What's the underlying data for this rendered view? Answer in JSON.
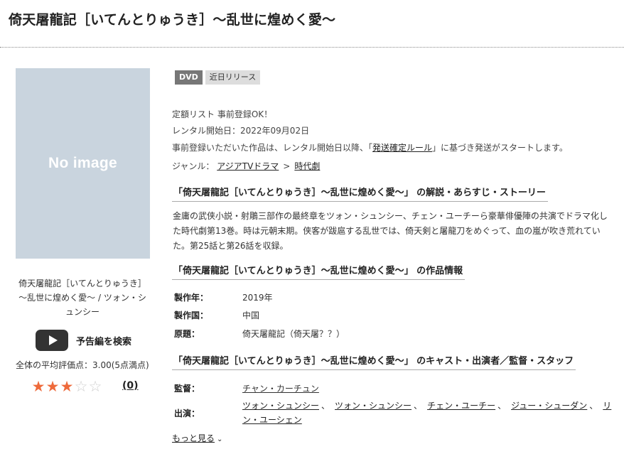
{
  "page_title": "倚天屠龍記［いてんとりゅうき］～乱世に煌めく愛～",
  "cover": {
    "placeholder_text": "No image"
  },
  "left": {
    "title_line1": "倚天屠龍記［いてんとりゅうき］",
    "title_line2": "～乱世に煌めく愛～ / ツォン・シ",
    "title_line3": "ュンシー",
    "trailer_label": "予告編を検索",
    "trailer_icon": "play-icon",
    "avg_rating_text": "全体の平均評価点：3.00(5点満点)",
    "rating": 3,
    "rating_max": 5,
    "star_color": "#ee6a3b",
    "review_count_open": "(",
    "review_count": "0",
    "review_count_close": ")"
  },
  "badges": {
    "format": "DVD",
    "status": "近日リリース"
  },
  "info": {
    "line1": "定額リスト 事前登録OK！",
    "line2": "レンタル開始日：2022年09月02日",
    "line3_pre": "事前登録いただいた作品は、レンタル開始日以降、「",
    "line3_link": "発送確定ルール",
    "line3_post": "」に基づき発送がスタートします。",
    "genre_label": "ジャンル：",
    "genre_1": "アジアTVドラマ",
    "genre_sep": ">",
    "genre_2": "時代劇"
  },
  "synopsis": {
    "heading": "「倚天屠龍記［いてんとりゅうき］～乱世に煌めく愛～」 の解説・あらすじ・ストーリー",
    "text": "金庸の武侠小説・射鵰三部作の最終章をツォン・シュンシー、チェン・ユーチーら豪華俳優陣の共演でドラマ化した時代劇第13巻。時は元朝末期。侠客が跋扈する乱世では、倚天剣と屠龍刀をめぐって、血の嵐が吹き荒れていた。第25話と第26話を収録。"
  },
  "work_info": {
    "heading": "「倚天屠龍記［いてんとりゅうき］～乱世に煌めく愛～」 の作品情報",
    "year_label": "製作年：",
    "year": "2019年",
    "country_label": "製作国：",
    "country": "中国",
    "original_label": "原題：",
    "original": "倚天屠龍記（倚天屠？？）"
  },
  "cast": {
    "heading": "「倚天屠龍記［いてんとりゅうき］～乱世に煌めく愛～」 のキャスト・出演者／監督・スタッフ",
    "director_label": "監督：",
    "director": "チャン・カーチュン",
    "actors_label": "出演：",
    "actor_1": "ツォン・シュンシー",
    "actor_2": "ツォン・シュンシー",
    "actor_3": "チェン・ユーチー",
    "actor_4": "ジュー・シューダン",
    "actor_5": "リン・ユーシェン",
    "separator": "、"
  },
  "more": {
    "label": "もっと見る",
    "icon": "chevron-down-icon"
  }
}
